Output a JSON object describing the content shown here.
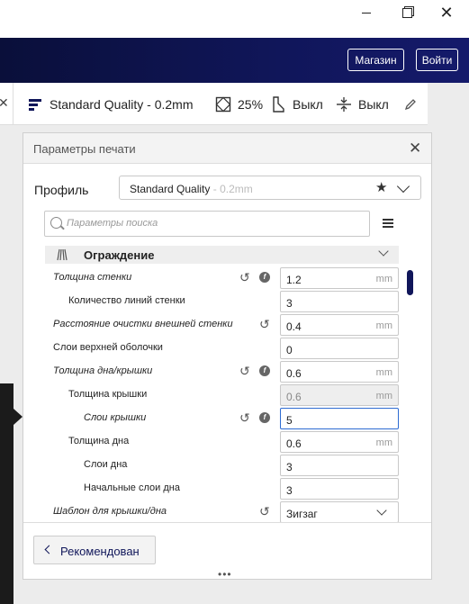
{
  "window": {
    "close_glyph": "✕"
  },
  "header": {
    "store_label": "Магазин",
    "login_label": "Войти"
  },
  "toolbar": {
    "profile": "Standard Quality - 0.2mm",
    "infill": "25%",
    "support": "Выкл",
    "adhesion": "Выкл"
  },
  "panel": {
    "title": "Параметры печати",
    "profile_label": "Профиль",
    "profile_value": "Standard Quality",
    "profile_value_dim": "- 0.2mm",
    "search_placeholder": "Параметры поиска",
    "category": "Ограждение",
    "rows": [
      {
        "label": "Толщина стенки",
        "value": "1.2",
        "unit": "mm"
      },
      {
        "label": "Количество линий стенки",
        "value": "3",
        "unit": ""
      },
      {
        "label": "Расстояние очистки внешней стенки",
        "value": "0.4",
        "unit": "mm"
      },
      {
        "label": "Слои верхней оболочки",
        "value": "0",
        "unit": ""
      },
      {
        "label": "Толщина дна/крышки",
        "value": "0.6",
        "unit": "mm"
      },
      {
        "label": "Толщина крышки",
        "value": "0.6",
        "unit": "mm"
      },
      {
        "label": "Слои крышки",
        "value": "5",
        "unit": ""
      },
      {
        "label": "Толщина дна",
        "value": "0.6",
        "unit": "mm"
      },
      {
        "label": "Слои дна",
        "value": "3",
        "unit": ""
      },
      {
        "label": "Начальные слои дна",
        "value": "3",
        "unit": ""
      },
      {
        "label": "Шаблон для крышки/дна",
        "value": "Зигзаг",
        "unit": ""
      }
    ],
    "recommended_label": "Рекомендован"
  },
  "colors": {
    "accent": "#10165a",
    "focus": "#2d6bd2"
  }
}
